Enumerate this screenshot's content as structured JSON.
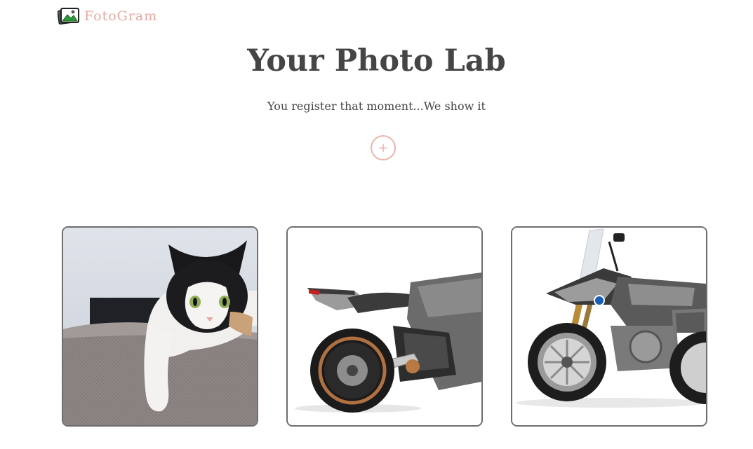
{
  "brand": {
    "name": "FotoGram",
    "icon": "photo-gallery-icon"
  },
  "hero": {
    "title": "Your Photo Lab",
    "subtitle": "You register that moment...We show it",
    "add_label": "+"
  },
  "gallery": [
    {
      "subject": "black-and-white-cat"
    },
    {
      "subject": "gray-electric-motorcycle"
    },
    {
      "subject": "bmw-adventure-motorcycle"
    }
  ],
  "colors": {
    "accent": "#eeb3aa",
    "text": "#454545",
    "card_border": "#6e6e6e"
  }
}
